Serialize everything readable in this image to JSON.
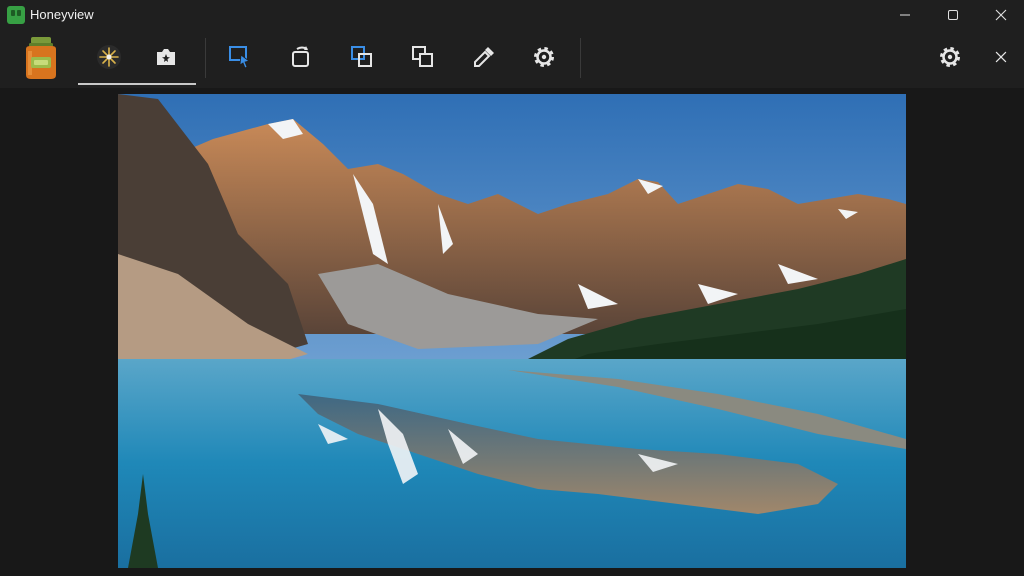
{
  "window": {
    "title": "Honeyview",
    "minimize_icon": "minimize-icon",
    "maximize_icon": "maximize-icon",
    "close_icon": "close-icon"
  },
  "toolbar": {
    "logo_icon": "honey-jar-icon",
    "buttons": [
      {
        "name": "sparkle-tool",
        "icon": "sparkle-icon",
        "active": true
      },
      {
        "name": "camera-tool",
        "icon": "camera-icon"
      },
      {
        "name": "select-tool",
        "icon": "cursor-select-icon"
      },
      {
        "name": "rotate-tool",
        "icon": "rotate-icon"
      },
      {
        "name": "copy-tool",
        "icon": "copy-icon"
      },
      {
        "name": "duplicate-tool",
        "icon": "duplicate-icon"
      },
      {
        "name": "eyedropper-tool",
        "icon": "eyedropper-icon"
      },
      {
        "name": "settings-tool",
        "icon": "gear-icon"
      }
    ],
    "right_settings_icon": "gear-icon",
    "right_close_icon": "close-icon",
    "accent": "#3a8ee6"
  },
  "viewer": {
    "image_subject": "mountain-lake-landscape"
  }
}
